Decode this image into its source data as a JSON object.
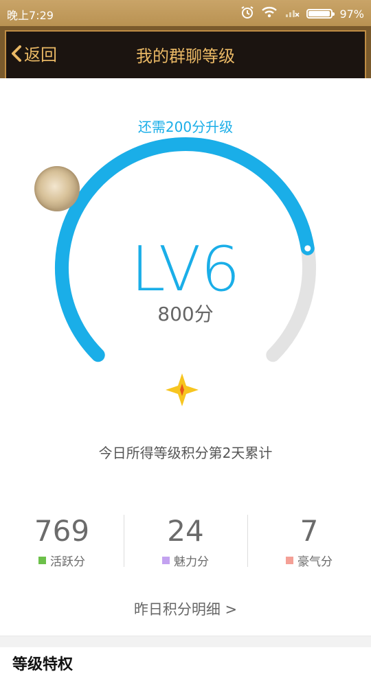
{
  "status_bar": {
    "time": "晚上7:29",
    "battery": "97%"
  },
  "nav": {
    "back_label": "返回",
    "title": "我的群聊等级"
  },
  "level_panel": {
    "upgrade_hint": "还需200分升级",
    "level": "LV6",
    "points": "800分",
    "progress_fraction": 0.8,
    "daily_note": "今日所得等级积分第2天累计"
  },
  "stats": [
    {
      "value": "769",
      "label": "活跃分",
      "color": "#6cc04a"
    },
    {
      "value": "24",
      "label": "魅力分",
      "color": "#c3a2f0"
    },
    {
      "value": "7",
      "label": "豪气分",
      "color": "#f4a096"
    }
  ],
  "detail_link": "昨日积分明细 >",
  "bottom_section": {
    "title": "等级特权"
  },
  "colors": {
    "accent": "#1aaee8",
    "track": "#e3e3e3",
    "header_gold": "#e9b865"
  }
}
